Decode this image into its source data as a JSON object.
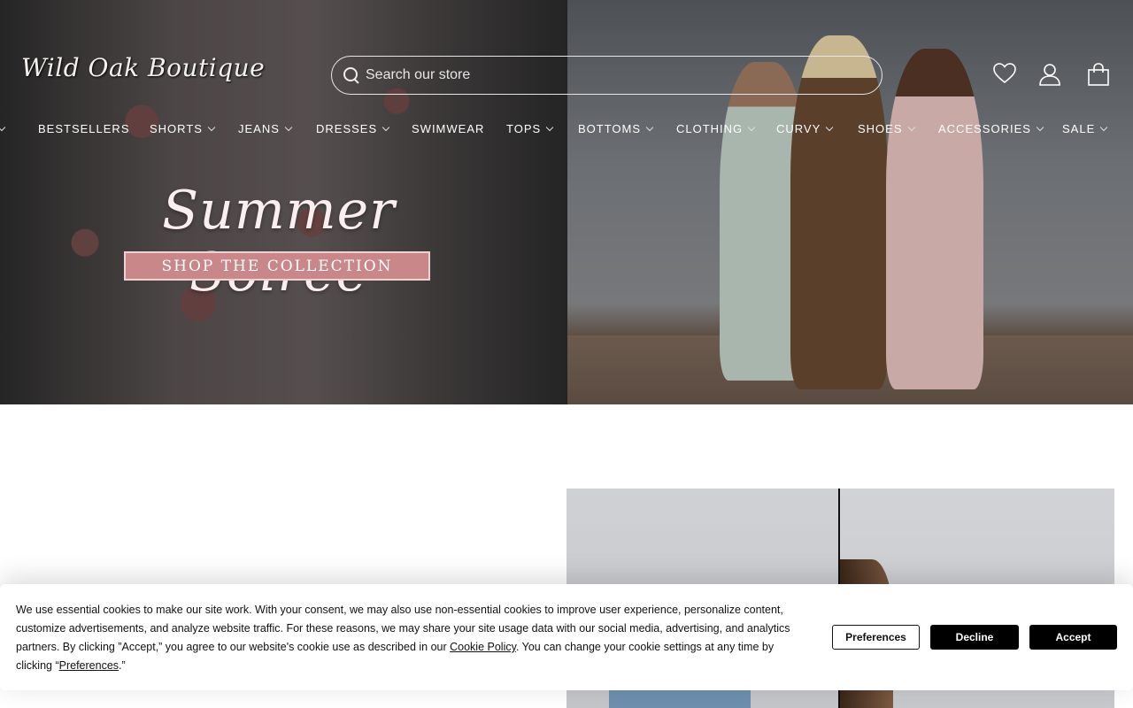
{
  "header": {
    "logo": "Wild Oak Boutique",
    "search_placeholder": "Search our store"
  },
  "nav": {
    "items": [
      {
        "label": "",
        "chevron": true
      },
      {
        "label": "BESTSELLERS",
        "chevron": false
      },
      {
        "label": "SHORTS",
        "chevron": true
      },
      {
        "label": "JEANS",
        "chevron": true
      },
      {
        "label": "DRESSES",
        "chevron": true
      },
      {
        "label": "SWIMWEAR",
        "chevron": false
      },
      {
        "label": "TOPS",
        "chevron": true
      },
      {
        "label": "BOTTOMS",
        "chevron": true
      },
      {
        "label": "CLOTHING",
        "chevron": true
      },
      {
        "label": "CURVY",
        "chevron": true
      },
      {
        "label": "SHOES",
        "chevron": true
      },
      {
        "label": "ACCESSORIES",
        "chevron": true
      },
      {
        "label": "SALE",
        "chevron": true
      }
    ]
  },
  "hero": {
    "title": "Summer Soiree",
    "cta": "SHOP THE COLLECTION"
  },
  "cookie": {
    "text_before": "We use essential cookies to make our site work. With your consent, we may also use non-essential cookies to improve user experience, personalize content, customize advertisements, and analyze website traffic. For these reasons, we may share your site usage data with our social media, advertising, and analytics partners. By clicking ”Accept,” you agree to our website's cookie use as described in our ",
    "policy_link": "Cookie Policy",
    "text_middle": ". You can change your cookie settings at any time by clicking “",
    "pref_link": "Preferences",
    "text_after": ".”",
    "preferences_label": "Preferences",
    "decline_label": "Decline",
    "accept_label": "Accept"
  },
  "icons": {
    "wishlist": "heart-icon",
    "account": "user-icon",
    "cart": "shopping-bag-icon",
    "search": "search-icon"
  }
}
